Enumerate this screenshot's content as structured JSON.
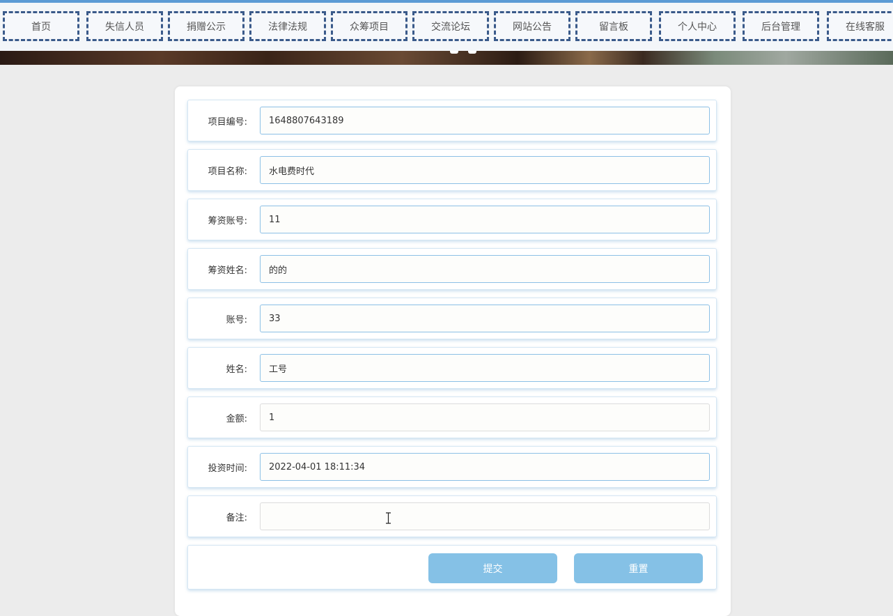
{
  "nav": {
    "items": [
      {
        "label": "首页"
      },
      {
        "label": "失信人员"
      },
      {
        "label": "捐赠公示"
      },
      {
        "label": "法律法规"
      },
      {
        "label": "众筹项目"
      },
      {
        "label": "交流论坛"
      },
      {
        "label": "网站公告"
      },
      {
        "label": "留言板"
      },
      {
        "label": "个人中心"
      },
      {
        "label": "后台管理"
      },
      {
        "label": "在线客服"
      }
    ]
  },
  "form": {
    "fields": [
      {
        "label": "项目编号:",
        "value": "1648807643189"
      },
      {
        "label": "项目名称:",
        "value": "水电费时代"
      },
      {
        "label": "筹资账号:",
        "value": "11"
      },
      {
        "label": "筹资姓名:",
        "value": "的的"
      },
      {
        "label": "账号:",
        "value": "33"
      },
      {
        "label": "姓名:",
        "value": "工号"
      },
      {
        "label": "金额:",
        "value": "1"
      },
      {
        "label": "投资时间:",
        "value": "2022-04-01 18:11:34"
      },
      {
        "label": "备注:",
        "value": ""
      }
    ],
    "submit_label": "提交",
    "reset_label": "重置"
  },
  "colors": {
    "accent": "#85c1e6",
    "nav_border": "#3a5a8a",
    "input_border": "#8cc0e6"
  }
}
